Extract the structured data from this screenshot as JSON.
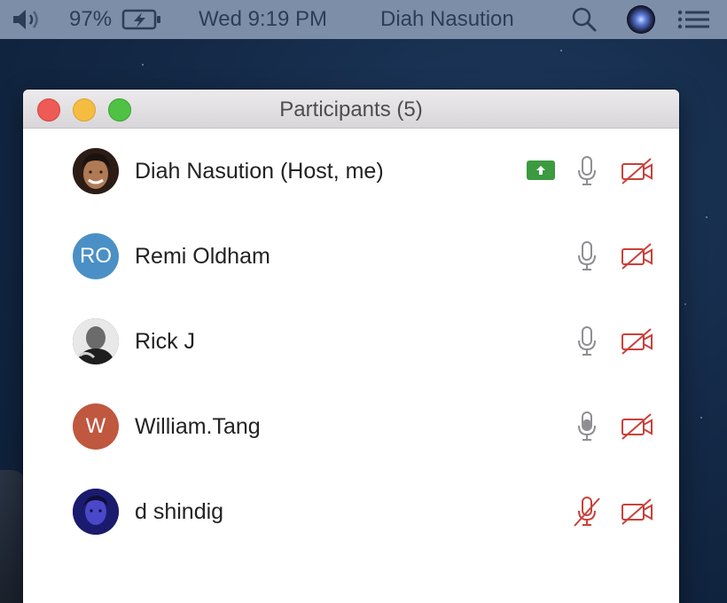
{
  "menubar": {
    "volume_icon": "volume-icon",
    "battery_percent": "97%",
    "battery_icon": "battery-charging-icon",
    "clock": "Wed 9:19 PM",
    "username": "Diah Nasution",
    "search_icon": "search-icon",
    "siri_icon": "siri-icon",
    "list_icon": "notification-list-icon"
  },
  "window": {
    "title": "Participants (5)"
  },
  "participants": [
    {
      "name": "Diah Nasution (Host, me)",
      "avatar": "photo",
      "initials": "",
      "avatar_color": "#8a5a3c",
      "sharing": true,
      "mic": "on",
      "video": "off"
    },
    {
      "name": "Remi Oldham",
      "avatar": "initials",
      "initials": "RO",
      "avatar_color": "#4a90c6",
      "sharing": false,
      "mic": "on",
      "video": "off"
    },
    {
      "name": "Rick J",
      "avatar": "photo",
      "initials": "",
      "avatar_color": "#3a3a3a",
      "sharing": false,
      "mic": "on",
      "video": "off"
    },
    {
      "name": "William.Tang",
      "avatar": "initials",
      "initials": "W",
      "avatar_color": "#c0573f",
      "sharing": false,
      "mic": "speaking",
      "video": "off"
    },
    {
      "name": "d shindig",
      "avatar": "photo",
      "initials": "",
      "avatar_color": "#2a2a8a",
      "sharing": false,
      "mic": "muted",
      "video": "off"
    }
  ],
  "colors": {
    "menubar_bg": "#7d8fa8",
    "muted_red": "#c9413a",
    "mic_gray": "#8e8e93",
    "share_green": "#3c9a3f"
  }
}
